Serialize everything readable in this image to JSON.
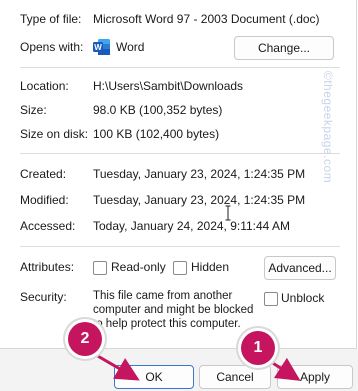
{
  "file_info": {
    "type_label": "Type of file:",
    "type_value": "Microsoft Word 97 - 2003 Document (.doc)",
    "opens_label": "Opens with:",
    "opens_app": "Word",
    "change_button": "Change...",
    "location_label": "Location:",
    "location_value": "H:\\Users\\Sambit\\Downloads",
    "size_label": "Size:",
    "size_value": "98.0 KB (100,352 bytes)",
    "size_on_disk_label": "Size on disk:",
    "size_on_disk_value": "100 KB (102,400 bytes)"
  },
  "dates": {
    "created_label": "Created:",
    "created_value": "Tuesday, January 23, 2024, 1:24:35 PM",
    "modified_label": "Modified:",
    "modified_value": "Tuesday, January 23, 2024, 1:24:35 PM",
    "accessed_label": "Accessed:",
    "accessed_value": "Today, January 24, 2024, 9:11:44 AM"
  },
  "attributes": {
    "label": "Attributes:",
    "readonly_label": "Read-only",
    "hidden_label": "Hidden",
    "advanced_button": "Advanced..."
  },
  "security": {
    "label": "Security:",
    "message": "This file came from another computer and might be blocked to help protect this computer.",
    "unblock_label": "Unblock"
  },
  "footer": {
    "ok_label": "OK",
    "cancel_label": "Cancel",
    "apply_label": "Apply"
  },
  "annotations": {
    "callout_1": "1",
    "callout_2": "2",
    "watermark": "©thegeekpage.com"
  },
  "colors": {
    "callout": "#c5155e",
    "arrow": "#c5155e",
    "word_icon": "#185abd"
  }
}
